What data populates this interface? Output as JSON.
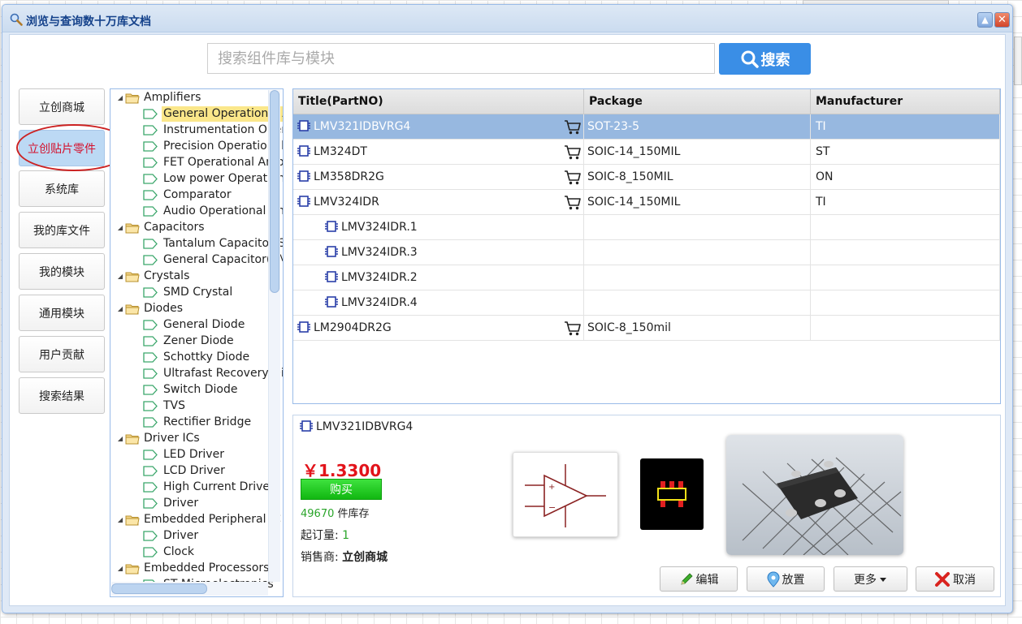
{
  "window": {
    "title": "浏览与查询数十万库文档",
    "minimize_symbol": "▲",
    "close_symbol": "✕"
  },
  "search": {
    "placeholder": "搜索组件库与模块",
    "button_label": "搜索"
  },
  "nav": {
    "items": [
      {
        "label": "立创商城"
      },
      {
        "label": "立创贴片零件",
        "active": true
      },
      {
        "label": "系统库"
      },
      {
        "label": "我的库文件"
      },
      {
        "label": "我的模块"
      },
      {
        "label": "通用模块"
      },
      {
        "label": "用户贡献"
      },
      {
        "label": "搜索结果"
      }
    ]
  },
  "tree": {
    "items": [
      {
        "label": "Amplifiers",
        "type": "folder"
      },
      {
        "label": "General Operational Amplifiers",
        "type": "leaf",
        "selected": true
      },
      {
        "label": "Instrumentation Operational Amplifiers",
        "type": "leaf"
      },
      {
        "label": "Precision Operational Amplifiers",
        "type": "leaf"
      },
      {
        "label": "FET Operational Amplifiers",
        "type": "leaf"
      },
      {
        "label": "Low power Operational Amplifiers",
        "type": "leaf"
      },
      {
        "label": "Comparator",
        "type": "leaf"
      },
      {
        "label": "Audio Operational Amplifiers",
        "type": "leaf"
      },
      {
        "label": "Capacitors",
        "type": "folder"
      },
      {
        "label": "Tantalum Capacitor(SMD)",
        "type": "leaf"
      },
      {
        "label": "General Capacitor(SMD)",
        "type": "leaf"
      },
      {
        "label": "Crystals",
        "type": "folder"
      },
      {
        "label": "SMD Crystal",
        "type": "leaf"
      },
      {
        "label": "Diodes",
        "type": "folder"
      },
      {
        "label": "General Diode",
        "type": "leaf"
      },
      {
        "label": "Zener Diode",
        "type": "leaf"
      },
      {
        "label": "Schottky Diode",
        "type": "leaf"
      },
      {
        "label": "Ultrafast Recovery Diode",
        "type": "leaf"
      },
      {
        "label": "Switch Diode",
        "type": "leaf"
      },
      {
        "label": "TVS",
        "type": "leaf"
      },
      {
        "label": "Rectifier Bridge",
        "type": "leaf"
      },
      {
        "label": "Driver ICs",
        "type": "folder"
      },
      {
        "label": "LED Driver",
        "type": "leaf"
      },
      {
        "label": "LCD Driver",
        "type": "leaf"
      },
      {
        "label": "High Current Driver",
        "type": "leaf"
      },
      {
        "label": "Driver",
        "type": "leaf"
      },
      {
        "label": "Embedded Peripheral IC",
        "type": "folder"
      },
      {
        "label": "Driver",
        "type": "leaf"
      },
      {
        "label": "Clock",
        "type": "leaf"
      },
      {
        "label": "Embedded Processors",
        "type": "folder"
      },
      {
        "label": "ST Microelectronics",
        "type": "leaf"
      }
    ]
  },
  "table": {
    "columns": [
      "Title(PartNO)",
      "Package",
      "Manufacturer"
    ],
    "rows": [
      {
        "title": "LMV321IDBVRG4",
        "package": "SOT-23-5",
        "manufacturer": "TI",
        "cart": true,
        "selected": true
      },
      {
        "title": "LM324DT",
        "package": "SOIC-14_150MIL",
        "manufacturer": "ST",
        "cart": true
      },
      {
        "title": "LM358DR2G",
        "package": "SOIC-8_150MIL",
        "manufacturer": "ON",
        "cart": true
      },
      {
        "title": "LMV324IDR",
        "package": "SOIC-14_150MIL",
        "manufacturer": "TI",
        "cart": true
      },
      {
        "title": "LMV324IDR.1",
        "package": "",
        "manufacturer": "",
        "child": true
      },
      {
        "title": "LMV324IDR.3",
        "package": "",
        "manufacturer": "",
        "child": true
      },
      {
        "title": "LMV324IDR.2",
        "package": "",
        "manufacturer": "",
        "child": true
      },
      {
        "title": "LMV324IDR.4",
        "package": "",
        "manufacturer": "",
        "child": true
      },
      {
        "title": "LM2904DR2G",
        "package": "SOIC-8_150mil",
        "manufacturer": "",
        "cart": true
      }
    ]
  },
  "detail": {
    "title": "LMV321IDBVRG4",
    "price": "￥1.3300",
    "buy_label": "购买",
    "stock_count": "49670",
    "stock_suffix": "件库存",
    "moq_label": "起订量:",
    "moq_value": "1",
    "seller_label": "销售商:",
    "seller_value": "立创商城",
    "symbol_plus": "+",
    "symbol_minus": "−"
  },
  "actions": {
    "edit": "编辑",
    "place": "放置",
    "more": "更多",
    "cancel": "取消"
  },
  "colors": {
    "accent": "#3a8ee6",
    "price": "#e2131a",
    "buy": "#22c922",
    "selected_row": "#97b8e0",
    "tree_selected": "#fbe78a"
  }
}
